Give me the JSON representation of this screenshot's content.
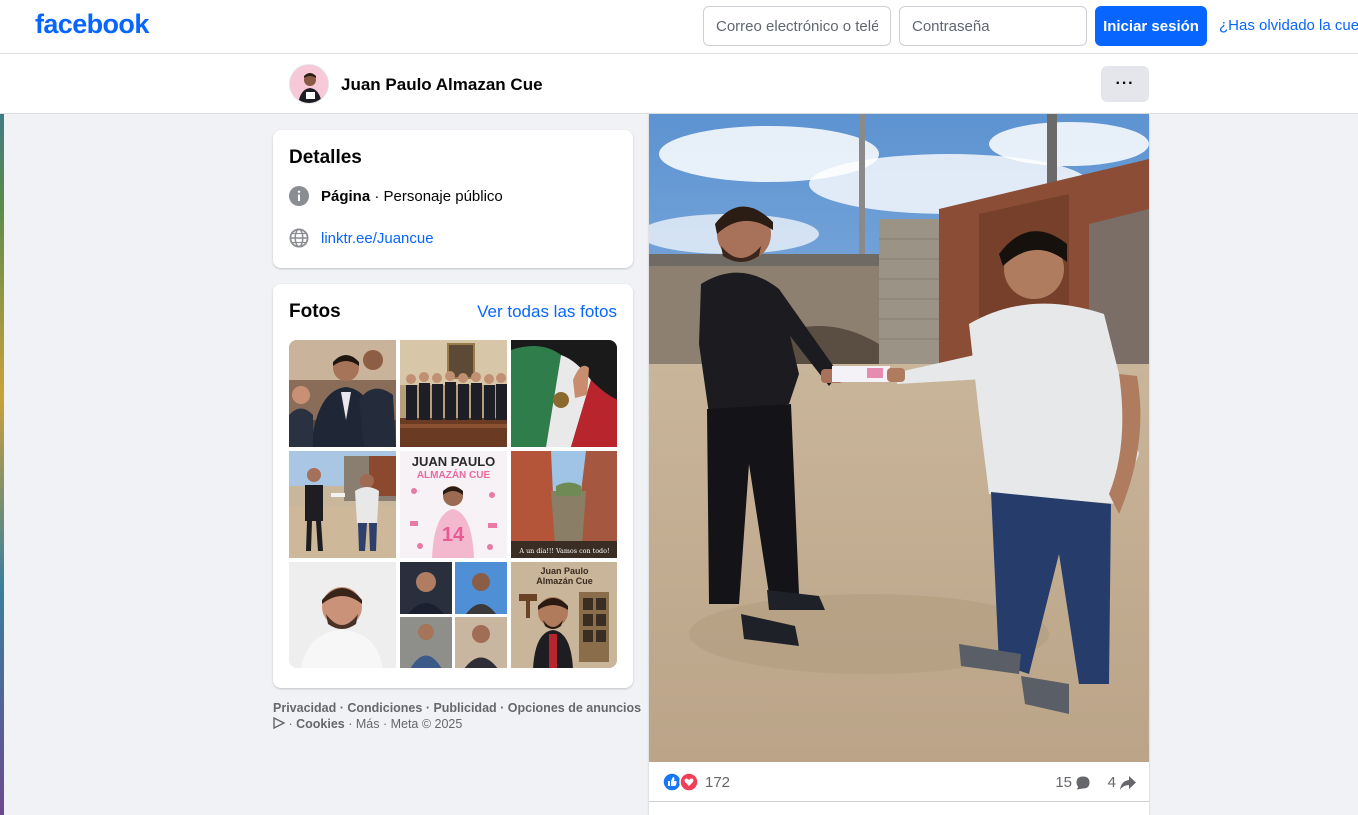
{
  "brand": {
    "logo_text": "facebook",
    "color": "#0866ff"
  },
  "login": {
    "email_placeholder": "Correo electrónico o teléfono",
    "password_placeholder": "Contraseña",
    "login_label": "Iniciar sesión",
    "forgot_label": "¿Has olvidado la cuenta?"
  },
  "profile": {
    "name": "Juan Paulo Almazan Cue",
    "more_label": "···"
  },
  "details": {
    "title": "Detalles",
    "category_strong": "Página",
    "category_rest": " · Personaje público",
    "link": "linktr.ee/Juancue"
  },
  "photos": {
    "title": "Fotos",
    "see_all": "Ver todas las fotos",
    "thumbs": [
      "Juan Paulo en reunión",
      "Foto grupal en salón",
      "Bandera de México",
      "Entrega de documento",
      "JUAN PAULO ALMAZÁN CUE",
      "A un día!!! Vamos con todo!",
      "Retrato",
      "Collage de fotos",
      "Juan Paulo Almazán Cue"
    ],
    "poster_title": "JUAN PAULO",
    "poster_sub": "ALMAZÁN CUE",
    "poster_number": "14",
    "street_caption": "A un día!!! Vamos con todo!",
    "caricature_title_1": "Juan Paulo",
    "caricature_title_2": "Almazán Cue"
  },
  "footer": {
    "line1": "Privacidad · Condiciones · Publicidad · Opciones de anuncios",
    "line2_a": "Cookies",
    "line2_b": " · Más · Meta © 2025"
  },
  "post": {
    "reaction_count": "172",
    "comment_count": "15",
    "share_count": "4",
    "reaction_types": [
      "like",
      "love"
    ]
  },
  "colors": {
    "accent": "#0866ff",
    "background": "#f0f2f5",
    "secondary_text": "#65676b"
  }
}
